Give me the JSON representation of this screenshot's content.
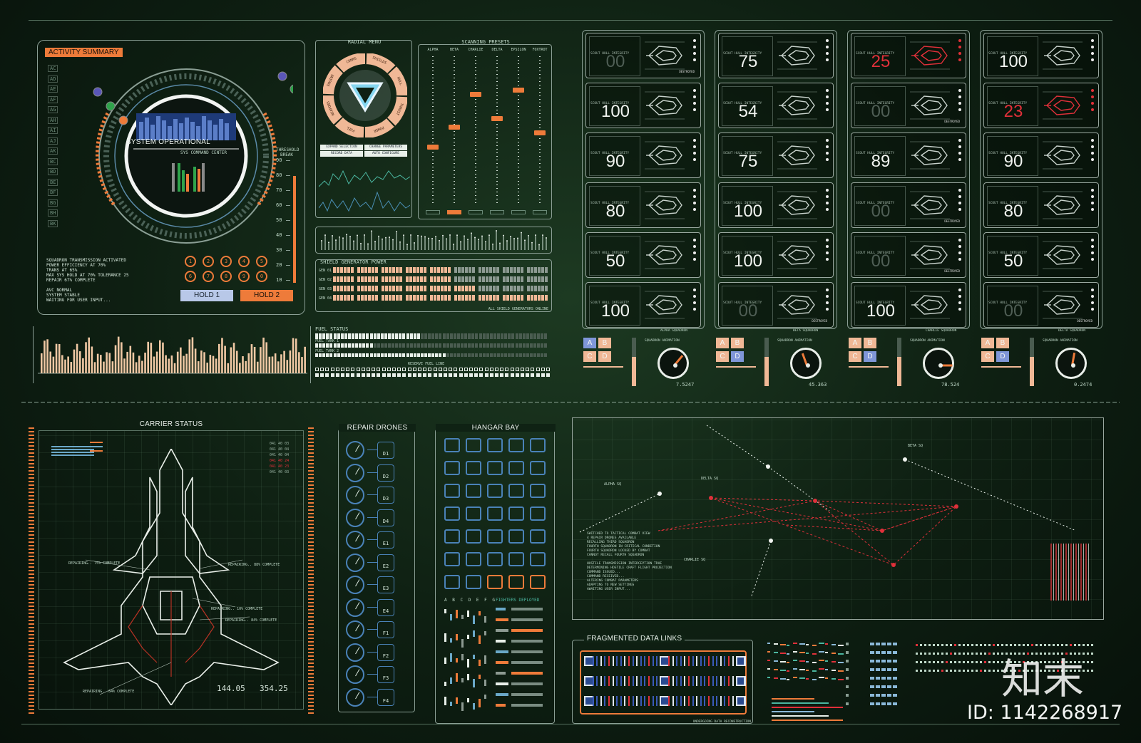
{
  "activity": {
    "title": "ACTIVITY SUMMARY",
    "status": "SYSTEM OPERATIONAL",
    "sub": "SYS COMMAND CENTER",
    "log": [
      "SQUADRON TRANSMISSION ACTIVATED",
      "POWER EFFICIENCY AT 70%",
      "TRANS AT 65%",
      "MAX SYS HOLD AT 70% TOLERANCE 25",
      "REPAIR 67% COMPLETE",
      "",
      "AVC NORMAL",
      "SYSTEM STABLE",
      "WAITING FOR USER INPUT..."
    ],
    "row_codes": [
      "AC",
      "AD",
      "AE",
      "AF",
      "AG",
      "AH",
      "AI",
      "AJ",
      "AK",
      "BC",
      "BD",
      "BE",
      "BF",
      "BG",
      "BH",
      "BK"
    ],
    "num_buttons": [
      "1",
      "2",
      "3",
      "4",
      "5",
      "6",
      "7",
      "8",
      "9",
      "0"
    ],
    "hold1": "HOLD 1",
    "hold2": "HOLD 2",
    "threshold_label": "THRESHOLD BREAK",
    "threshold_ticks": [
      "90",
      "80",
      "70",
      "60",
      "50",
      "40",
      "30",
      "20",
      "10"
    ]
  },
  "radial": {
    "title": "RADIAL MENU",
    "segments": [
      "COMMS",
      "SHIELDS",
      "HULL",
      "THRUST",
      "POWER",
      "FUEL",
      "WEAPONS",
      "ENGINE"
    ],
    "actions": [
      "EXPAND SELECTION",
      "CHANGE PARAMETERS",
      "RECORD DATA",
      "AUTO CONFIGURE"
    ]
  },
  "presets": {
    "title": "SCANNING PRESETS",
    "channels": [
      "ALPHA",
      "BETA",
      "CHARLIE",
      "DELTA",
      "EPSILON",
      "FOXTROT"
    ]
  },
  "shield": {
    "title": "SHIELD GENERATOR POWER",
    "rows": [
      "GEN 01",
      "GEN 02",
      "GEN 03",
      "GEN 04"
    ],
    "footer": "ALL SHIELD GENERATORS ONLINE"
  },
  "fuel": {
    "title": "FUEL STATUS",
    "tank1": "FUEL TANK 1",
    "tank2": "FUEL TANK 2",
    "reserve": "RESERVE FUEL LINE"
  },
  "sectors": {
    "label": "SCOUT HULL INTEGRITY",
    "destroyed": "DESTROYED",
    "columns": [
      {
        "name": "ALPHA SQUADRON",
        "values": [
          "00",
          "100",
          "90",
          "80",
          "50",
          "100"
        ],
        "readout": "7.5247"
      },
      {
        "name": "BETA SQUADRON",
        "values": [
          "75",
          "54",
          "75",
          "100",
          "100",
          "00"
        ],
        "readout": "45.363"
      },
      {
        "name": "CHARLIE SQUADRON",
        "values": [
          "25",
          "00",
          "89",
          "00",
          "00",
          "100"
        ],
        "readout": "78.524"
      },
      {
        "name": "DELTA SQUADRON",
        "values": [
          "100",
          "23",
          "90",
          "80",
          "50",
          "00"
        ],
        "readout": "0.2474"
      }
    ],
    "red_values": [
      "25",
      "23"
    ],
    "dim_values": [
      "00"
    ],
    "abcd": [
      "A",
      "B",
      "C",
      "D"
    ],
    "animation_label": "SQUADRON ANIMATION"
  },
  "carrier": {
    "title": "CARRIER STATUS",
    "readout_a": "144.05",
    "readout_b": "354.25",
    "notes": [
      "REPAIRING.. 75% COMPLETE",
      "REPAIRING.. 88% COMPLETE",
      "REPAIRING.. 10% COMPLETE",
      "REPAIRING.. 84% COMPLETE",
      "REPAIRING.. 84% COMPLETE"
    ],
    "codes": [
      "041 40 03",
      "041 40 04",
      "041 40 04",
      "041 40 24",
      "041 40 23",
      "041 40 03"
    ]
  },
  "drones": {
    "title": "REPAIR DRONES",
    "ids": [
      "D1",
      "D2",
      "D3",
      "D4",
      "E1",
      "E2",
      "E3",
      "E4",
      "F1",
      "F2",
      "F3",
      "F4"
    ]
  },
  "hangar": {
    "title": "HANGAR BAY",
    "letters": "A B C D E F G",
    "deployed": "FIGHTERS DEPLOYED"
  },
  "tactical": {
    "labels": [
      "ALPHA SQ",
      "BETA SQ",
      "DELTA SQ",
      "CHARLIE SQ"
    ],
    "log": [
      "SWITCHED TO TACTICAL COMBAT VIEW",
      "4 REPAIR DRONES AVAILABLE",
      "RECALLING THIRD SQUADRON",
      "FOURTH SQUADRON IN CRITICAL CONDITION",
      "FOURTH SQUADRON LOCKED BY COMBAT",
      "CANNOT RECALL FOURTH SQUADRON",
      "",
      "HOSTILE TRANSMISSION INTERCEPTION TRUE",
      "DETERMINING HOSTILE CRAFT FLIGHT PROJECTION",
      "COMMAND ISSUED...",
      "COMMAND RECEIVED...",
      "ALTERING COMBAT PARAMETERS",
      "ADAPTING TO NEW SETTINGS",
      "AWAITING USER INPUT..."
    ]
  },
  "links": {
    "title": "FRAGMENTED DATA LINKS",
    "footer": "UNDERGOING DATA RECONSTRUCTION"
  },
  "watermark": {
    "brand": "知末",
    "id": "ID: 1142268917"
  },
  "colors": {
    "accent": "#ee7b3a",
    "blue": "#4a82b8",
    "red": "#e0303a",
    "line": "#8a9e94"
  }
}
